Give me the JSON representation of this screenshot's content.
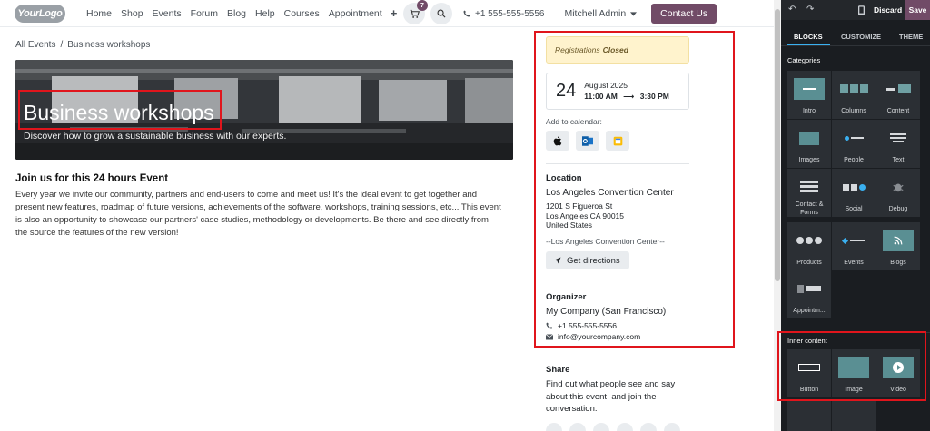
{
  "navbar": {
    "logo_text": "YourLogo",
    "menu": [
      "Home",
      "Shop",
      "Events",
      "Forum",
      "Blog",
      "Help",
      "Courses",
      "Appointment"
    ],
    "plus": "+",
    "cart_count": "7",
    "phone": "+1 555-555-5556",
    "user": "Mitchell Admin",
    "contact_button": "Contact Us"
  },
  "breadcrumb": {
    "parent": "All Events",
    "separator": "/",
    "current": "Business workshops"
  },
  "hero": {
    "title": "Business workshops",
    "subtitle": "Discover how to grow a sustainable business with our experts."
  },
  "intro": {
    "title": "Join us for this 24 hours Event",
    "text": "Every year we invite our community, partners and end-users to come and meet us! It's the ideal event to get together and present new features, roadmap of future versions, achievements of the software, workshops, training sessions, etc... This event is also an opportunity to showcase our partners' case studies, methodology or developments. Be there and see directly from the source the features of the new version!"
  },
  "sidebar": {
    "registration_prefix": "Registrations",
    "registration_status": "Closed",
    "date_day": "24",
    "date_month": "August 2025",
    "time_start": "11:00 AM",
    "time_arrow": "⟶",
    "time_end": "3:30 PM",
    "add_to_calendar": "Add to calendar:",
    "location_title": "Location",
    "location_name": "Los Angeles Convention Center",
    "address_line1": "1201 S Figueroa St",
    "address_line2": "Los Angeles CA 90015",
    "address_line3": "United States",
    "location_note": "--Los Angeles Convention Center--",
    "directions_button": "Get directions",
    "organizer_title": "Organizer",
    "organizer_name": "My Company (San Francisco)",
    "organizer_phone": "+1 555-555-5556",
    "organizer_email": "info@yourcompany.com",
    "share_title": "Share",
    "share_text": "Find out what people see and say about this event, and join the conversation."
  },
  "editor": {
    "discard": "Discard",
    "save": "Save",
    "tabs": [
      "BLOCKS",
      "CUSTOMIZE",
      "THEME"
    ],
    "categories_label": "Categories",
    "categories": [
      "Intro",
      "Columns",
      "Content",
      "Images",
      "People",
      "Text",
      "Contact & Forms",
      "Social",
      "Debug",
      "Products",
      "Events",
      "Blogs",
      "Appointm..."
    ],
    "inner_content_label": "Inner content",
    "inner_content": [
      "Button",
      "Image",
      "Video"
    ]
  },
  "colors": {
    "brand": "#714b67",
    "highlight_box": "#e0151c",
    "panel_bg": "#1a1d21",
    "accent_tab": "#3ab0f0"
  }
}
